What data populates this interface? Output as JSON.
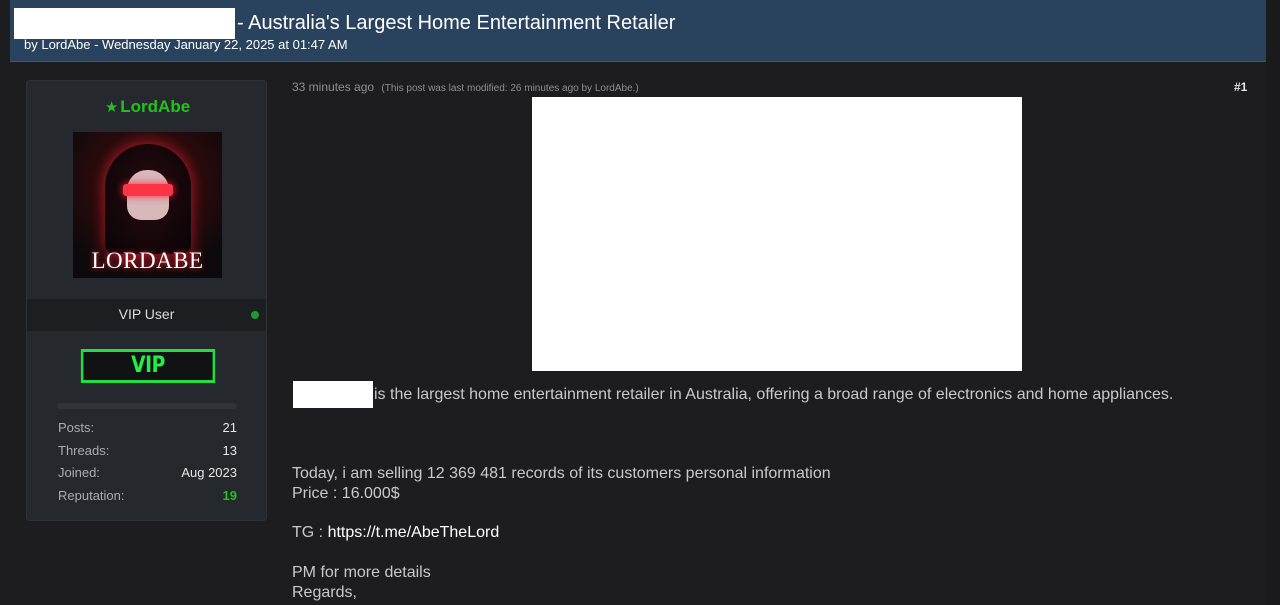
{
  "header": {
    "title": "- Australia's Largest Home Entertainment Retailer",
    "meta": "by LordAbe - Wednesday January 22, 2025 at 01:47 AM"
  },
  "author": {
    "username": "LordAbe",
    "avatar_text": "LORDABE",
    "rank": "VIP User",
    "badge": "VIP",
    "stats": [
      {
        "label": "Posts:",
        "value": "21"
      },
      {
        "label": "Threads:",
        "value": "13"
      },
      {
        "label": "Joined:",
        "value": "Aug 2023"
      },
      {
        "label": "Reputation:",
        "value": "19"
      }
    ]
  },
  "post": {
    "time": "33 minutes ago",
    "modified": "(This post was last modified: 26 minutes ago by LordAbe.)",
    "number": "#1",
    "intro": "is the largest home entertainment retailer in Australia, offering a broad range of electronics and home appliances.",
    "selling": "Today, i am selling 12 369 481 records of its customers personal information",
    "price": "Price : 16.000$",
    "tg_label": "TG : ",
    "tg_link": "https://t.me/AbeTheLord",
    "pm": "PM for more details",
    "regards": "Regards,"
  },
  "colors": {
    "header_bg": "#29435f",
    "username": "#22c31a",
    "vip_badge": "#22ee44"
  }
}
